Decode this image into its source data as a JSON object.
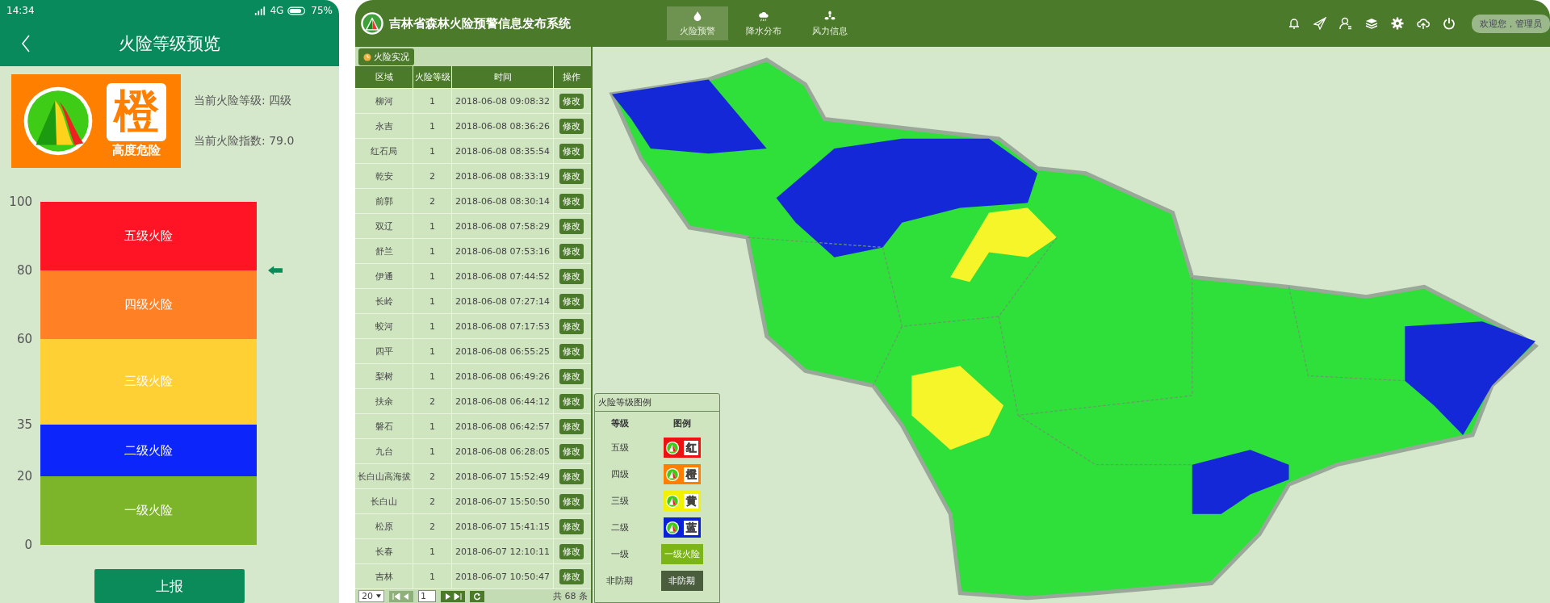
{
  "phone": {
    "status_bar": {
      "time": "14:34",
      "network": "4G",
      "battery": "75%"
    },
    "header": {
      "title": "火险等级预览"
    },
    "badge": {
      "char": "橙",
      "caption": "高度危险",
      "color": "#ff8000"
    },
    "info": [
      "当前火险等级: 四级",
      "当前火险指数: 79.0"
    ],
    "scale": {
      "ticks": [
        "100",
        "80",
        "60",
        "35",
        "20",
        "0"
      ],
      "bands": [
        {
          "label": "五级火险",
          "color": "#fe1424",
          "selected": false
        },
        {
          "label": "四级火险",
          "color": "#ff8025",
          "selected": true
        },
        {
          "label": "三级火险",
          "color": "#ffd034",
          "selected": false
        },
        {
          "label": "二级火险",
          "color": "#0b25fb",
          "selected": false
        },
        {
          "label": "一级火险",
          "color": "#7db52a",
          "selected": false
        }
      ]
    },
    "submit_button": "上报"
  },
  "web": {
    "title": "吉林省森林火险预警信息发布系统",
    "nav_tabs": [
      {
        "label": "火险预警",
        "kind": "fire",
        "selected": true
      },
      {
        "label": "降水分布",
        "kind": "rain",
        "selected": false
      },
      {
        "label": "风力信息",
        "kind": "wind",
        "selected": false
      }
    ],
    "user_greeting": "欢迎您，管理员",
    "panel_tab": "火险实况",
    "table": {
      "columns": [
        "区域",
        "火险等级",
        "时间",
        "操作"
      ],
      "rows": [
        {
          "region": "柳河",
          "fire_level": "1",
          "time": "2018-06-08 09:08:32",
          "action": "修改"
        },
        {
          "region": "永吉",
          "fire_level": "1",
          "time": "2018-06-08 08:36:26",
          "action": "修改"
        },
        {
          "region": "红石局",
          "fire_level": "1",
          "time": "2018-06-08 08:35:54",
          "action": "修改"
        },
        {
          "region": "乾安",
          "fire_level": "2",
          "time": "2018-06-08 08:33:19",
          "action": "修改"
        },
        {
          "region": "前郭",
          "fire_level": "2",
          "time": "2018-06-08 08:30:14",
          "action": "修改"
        },
        {
          "region": "双辽",
          "fire_level": "1",
          "time": "2018-06-08 07:58:29",
          "action": "修改"
        },
        {
          "region": "舒兰",
          "fire_level": "1",
          "time": "2018-06-08 07:53:16",
          "action": "修改"
        },
        {
          "region": "伊通",
          "fire_level": "1",
          "time": "2018-06-08 07:44:52",
          "action": "修改"
        },
        {
          "region": "长岭",
          "fire_level": "1",
          "time": "2018-06-08 07:27:14",
          "action": "修改"
        },
        {
          "region": "蛟河",
          "fire_level": "1",
          "time": "2018-06-08 07:17:53",
          "action": "修改"
        },
        {
          "region": "四平",
          "fire_level": "1",
          "time": "2018-06-08 06:55:25",
          "action": "修改"
        },
        {
          "region": "梨树",
          "fire_level": "1",
          "time": "2018-06-08 06:49:26",
          "action": "修改"
        },
        {
          "region": "扶余",
          "fire_level": "2",
          "time": "2018-06-08 06:44:12",
          "action": "修改"
        },
        {
          "region": "磐石",
          "fire_level": "1",
          "time": "2018-06-08 06:42:57",
          "action": "修改"
        },
        {
          "region": "九台",
          "fire_level": "1",
          "time": "2018-06-08 06:28:05",
          "action": "修改"
        },
        {
          "region": "长白山高海拔",
          "fire_level": "2",
          "time": "2018-06-07 15:52:49",
          "action": "修改"
        },
        {
          "region": "长白山",
          "fire_level": "2",
          "time": "2018-06-07 15:50:50",
          "action": "修改"
        },
        {
          "region": "松原",
          "fire_level": "2",
          "time": "2018-06-07 15:41:15",
          "action": "修改"
        },
        {
          "region": "长春",
          "fire_level": "1",
          "time": "2018-06-07 12:10:11",
          "action": "修改"
        },
        {
          "region": "吉林",
          "fire_level": "1",
          "time": "2018-06-07 10:50:47",
          "action": "修改"
        }
      ]
    },
    "pager": {
      "page_size": "20",
      "page": "1",
      "total": "共 68 条"
    },
    "legend": {
      "title": "火险等级图例",
      "columns": [
        "等级",
        "图例"
      ],
      "items": [
        {
          "label": "五级",
          "kind": "badge",
          "color": "#ee1111",
          "text": "红"
        },
        {
          "label": "四级",
          "kind": "badge",
          "color": "#ff8000",
          "text": "橙"
        },
        {
          "label": "三级",
          "kind": "badge",
          "color": "#f2f200",
          "text": "黄"
        },
        {
          "label": "二级",
          "kind": "badge",
          "color": "#0a1fd8",
          "text": "蓝"
        },
        {
          "label": "一级",
          "kind": "bar",
          "color": "#7cb518",
          "text": "一级火险"
        },
        {
          "label": "非防期",
          "kind": "bar",
          "color": "#4a5e3e",
          "text": "非防期"
        }
      ]
    }
  }
}
